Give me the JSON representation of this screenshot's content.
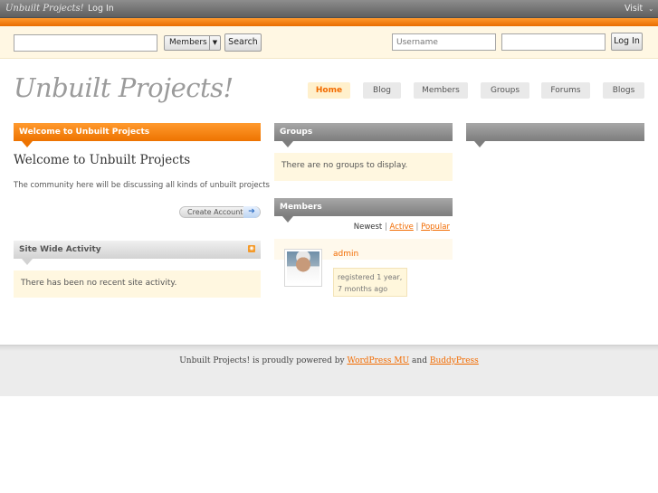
{
  "adminbar": {
    "site_title": "Unbuilt Projects!",
    "login_label": "Log In",
    "visit_label": "Visit",
    "visit_icon": "chevron-down-icon"
  },
  "search": {
    "query_value": "",
    "scope_selected": "Members",
    "search_button": "Search"
  },
  "login": {
    "username_placeholder": "Username",
    "password_value": "",
    "login_button": "Log In"
  },
  "header": {
    "logo": "Unbuilt Projects!",
    "nav": [
      "Home",
      "Blog",
      "Members",
      "Groups",
      "Forums",
      "Blogs"
    ],
    "active_nav": "Home"
  },
  "welcome_widget": {
    "header": "Welcome to Unbuilt Projects",
    "title": "Welcome to Unbuilt Projects",
    "description": "The community here will be discussing all kinds of unbuilt projects",
    "create_account_label": "Create Account",
    "create_account_icon": "arrow-right-icon"
  },
  "activity_widget": {
    "header": "Site Wide Activity",
    "rss_icon": "rss-icon",
    "message": "There has been no recent site activity."
  },
  "groups_widget": {
    "header": "Groups",
    "message": "There are no groups to display."
  },
  "members_widget": {
    "header": "Members",
    "filters": {
      "newest": "Newest",
      "active": "Active",
      "popular": "Popular",
      "separator": "|"
    },
    "member": {
      "name": "admin",
      "registered": "registered 1 year, 7 months ago"
    }
  },
  "footer": {
    "prefix": "Unbuilt Projects! is proudly powered by",
    "link1": "WordPress MU",
    "conjunction": "and",
    "link2": "BuddyPress"
  },
  "colors": {
    "accent": "#f26b00",
    "widget_bg": "#fff7e0",
    "search_bar_bg": "#fff7e3"
  }
}
